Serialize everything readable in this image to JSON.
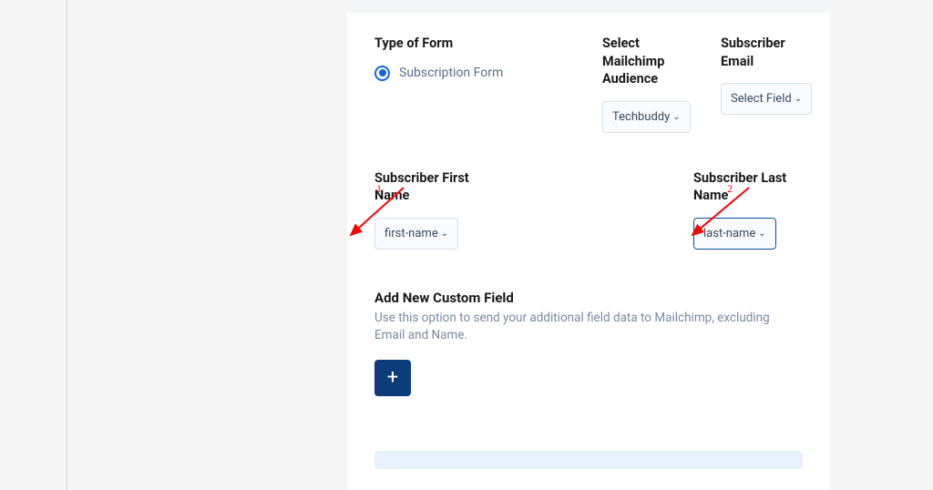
{
  "form": {
    "type_label": "Type of Form",
    "type_option": "Subscription Form",
    "audience_label": "Select Mailchimp Audience",
    "audience_value": "Techbuddy",
    "email_label": "Subscriber Email",
    "email_value": "Select Field",
    "firstname_label": "Subscriber First Name",
    "firstname_value": "first-name",
    "lastname_label": "Subscriber Last Name",
    "lastname_value": "last-name"
  },
  "custom": {
    "title": "Add New Custom Field",
    "desc": "Use this option to send your additional field data to Mailchimp, excluding Email and Name."
  },
  "annotations": {
    "arrow1": "1",
    "arrow2": "2"
  }
}
